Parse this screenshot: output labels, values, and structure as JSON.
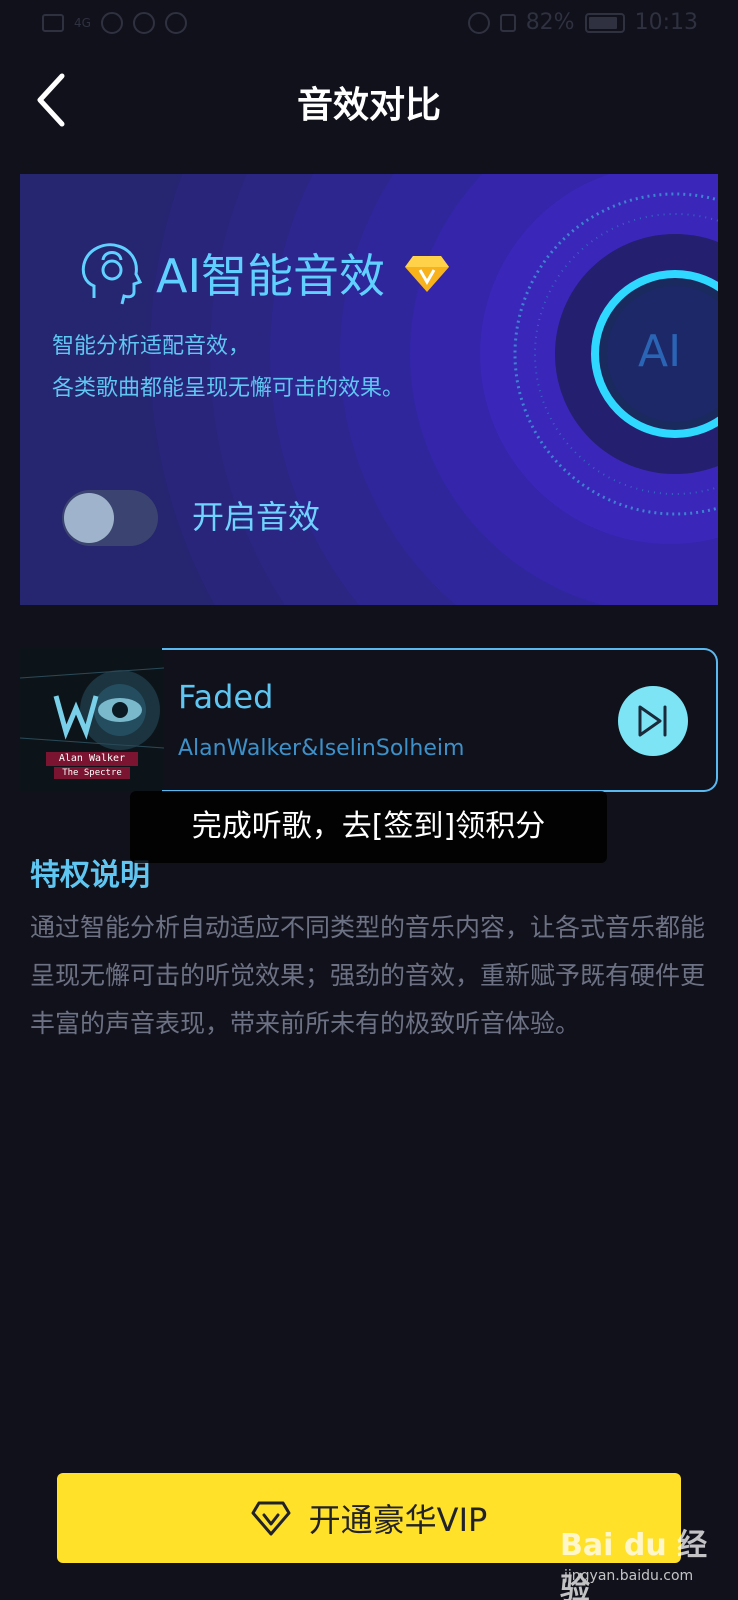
{
  "status_bar": {
    "battery": "82%",
    "time": "10:13",
    "network": "4G"
  },
  "header": {
    "title": "音效对比",
    "back_icon": "chevron-left-icon"
  },
  "banner": {
    "title": "AI智能音效",
    "description_line1": "智能分析适配音效，",
    "description_line2": "各类歌曲都能呈现无懈可击的效果。",
    "toggle_label": "开启音效",
    "toggle_on": false,
    "ai_badge": "AI",
    "accent_color": "#5fd0ff"
  },
  "song": {
    "title": "Faded",
    "artist": "AlanWalker&IselinSolheim",
    "album_line1": "Alan Walker",
    "album_line2": "The Spectre",
    "play_icon": "play-next-icon"
  },
  "toast": {
    "text": "完成听歌，去[签到]领积分"
  },
  "privilege": {
    "title": "特权说明",
    "description": "通过智能分析自动适应不同类型的音乐内容，让各式音乐都能呈现无懈可击的听觉效果；强劲的音效，重新赋予既有硬件更丰富的声音表现，带来前所未有的极致听音体验。"
  },
  "vip_button": {
    "label": "开通豪华VIP",
    "color": "#ffe12a",
    "icon": "diamond-icon"
  },
  "watermark": {
    "text": "Bai du 经验",
    "sub": "jingyan.baidu.com"
  }
}
